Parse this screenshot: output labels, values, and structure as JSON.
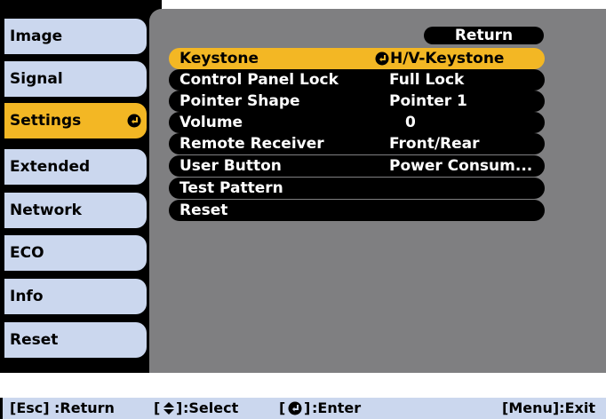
{
  "tabs": [
    {
      "label": "Image"
    },
    {
      "label": "Signal"
    },
    {
      "label": "Settings"
    },
    {
      "label": "Extended"
    },
    {
      "label": "Network"
    },
    {
      "label": "ECO"
    },
    {
      "label": "Info"
    },
    {
      "label": "Reset"
    }
  ],
  "selected_tab": "Settings",
  "return_label": "Return",
  "menu_rows": [
    {
      "label": "Keystone",
      "value": "H/V-Keystone"
    },
    {
      "label": "Control Panel Lock",
      "value": "Full Lock"
    },
    {
      "label": "Pointer Shape",
      "value": "Pointer 1"
    },
    {
      "label": "Volume",
      "value": "0"
    },
    {
      "label": "Remote Receiver",
      "value": "Front/Rear"
    },
    {
      "label": "User Button",
      "value": "Power Consum..."
    },
    {
      "label": "Test Pattern",
      "value": ""
    },
    {
      "label": "Reset",
      "value": ""
    }
  ],
  "help": {
    "esc": "[Esc]",
    "esc_action": ":Return",
    "select_open": "[",
    "select_close": "]",
    "select_action": ":Select",
    "enter_open": "[",
    "enter_close": "]",
    "enter_action": ":Enter",
    "menu": "[Menu]:Exit"
  },
  "colors": {
    "highlight": "#f3b724",
    "tab": "#cbd7ee",
    "panel": "#7f7f81",
    "row": "#000000"
  },
  "icons": {
    "enter": "enter-icon",
    "updown": "up-down-arrow-icon"
  }
}
